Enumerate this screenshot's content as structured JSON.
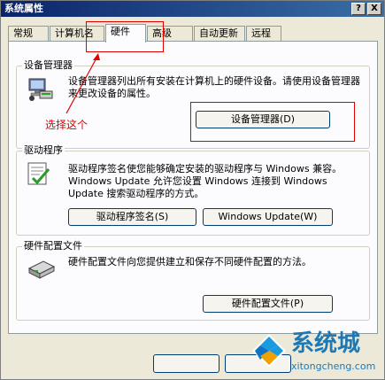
{
  "window": {
    "title": "系统属性",
    "help_btn": "?",
    "close_btn": "X"
  },
  "tabs": [
    "常规",
    "计算机名",
    "硬件",
    "高级",
    "自动更新",
    "远程"
  ],
  "device_manager": {
    "title": "设备管理器",
    "description": "设备管理器列出所有安装在计算机上的硬件设备。请使用设备管理器来更改设备的属性。",
    "button": "设备管理器(D)"
  },
  "drivers": {
    "title": "驱动程序",
    "description": "驱动程序签名使您能够确定安装的驱动程序与 Windows 兼容。Windows Update 允许您设置 Windows 连接到 Windows Update 搜索驱动程序的方式。",
    "signing_button": "驱动程序签名(S)",
    "update_button": "Windows Update(W)"
  },
  "hw_profiles": {
    "title": "硬件配置文件",
    "description": "硬件配置文件向您提供建立和保存不同硬件配置的方法。",
    "button": "硬件配置文件(P)"
  },
  "annotation": {
    "text": "选择这个",
    "color": "#e00000"
  },
  "watermark": {
    "name": "系统城",
    "url": "xitongcheng.com"
  }
}
